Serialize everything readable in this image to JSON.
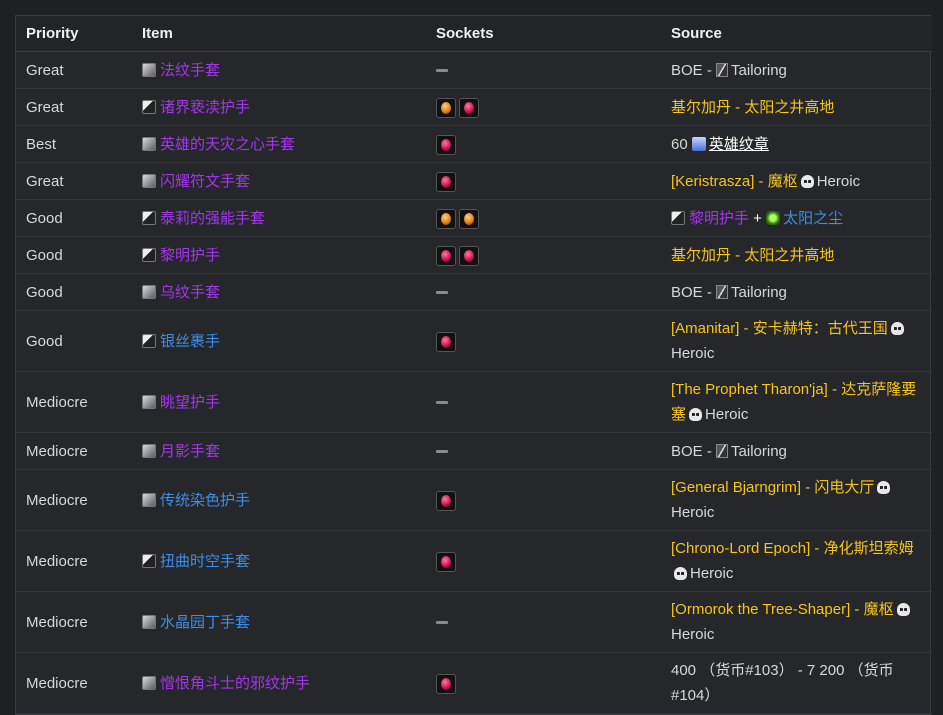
{
  "headers": {
    "priority": "Priority",
    "item": "Item",
    "sockets": "Sockets",
    "source": "Source"
  },
  "rows": [
    {
      "priority": "Great",
      "item": "法纹手套",
      "item_color": "purple",
      "icon": "cloth-gloves-icon",
      "sockets": [],
      "source": {
        "prefix": "BOE - ",
        "profession": "Tailoring"
      }
    },
    {
      "priority": "Great",
      "item": "诸界亵渎护手",
      "item_color": "purple",
      "icon": "dark-gloves-icon",
      "sockets": [
        "orange",
        "red"
      ],
      "source": {
        "npc": "基尔加丹",
        "sep": " - ",
        "zone": "太阳之井高地"
      }
    },
    {
      "priority": "Best",
      "item": "英雄的天灾之心手套",
      "item_color": "purple",
      "icon": "plate-gloves-icon",
      "sockets": [
        "red"
      ],
      "source": {
        "cost": "60 ",
        "currency": "英雄纹章"
      }
    },
    {
      "priority": "Great",
      "item": "闪耀符文手套",
      "item_color": "purple",
      "icon": "rune-gloves-icon",
      "sockets": [
        "red"
      ],
      "source": {
        "npc": "[Keristrasza]",
        "sep": " - ",
        "zone": "魔枢",
        "heroic": "Heroic"
      }
    },
    {
      "priority": "Good",
      "item": "泰莉的强能手套",
      "item_color": "purple",
      "icon": "hand-icon",
      "sockets": [
        "orange",
        "orange"
      ],
      "source": {
        "item_a": "黎明护手",
        "plus": " + ",
        "item_b": "太阳之尘"
      }
    },
    {
      "priority": "Good",
      "item": "黎明护手",
      "item_color": "purple",
      "icon": "hand-icon",
      "sockets": [
        "red",
        "red"
      ],
      "source": {
        "npc": "基尔加丹",
        "sep": " - ",
        "zone": "太阳之井高地"
      }
    },
    {
      "priority": "Good",
      "item": "乌纹手套",
      "item_color": "purple",
      "icon": "cloth-gloves-icon",
      "sockets": [],
      "source": {
        "prefix": "BOE - ",
        "profession": "Tailoring"
      }
    },
    {
      "priority": "Good",
      "item": "银丝裹手",
      "item_color": "blue",
      "icon": "hand-icon",
      "sockets": [
        "red"
      ],
      "source": {
        "npc": "[Amanitar]",
        "sep": " - ",
        "zone": "安卡赫特：古代王国",
        "heroic": "Heroic"
      }
    },
    {
      "priority": "Mediocre",
      "item": "眺望护手",
      "item_color": "purple",
      "icon": "mail-gloves-icon",
      "sockets": [],
      "source": {
        "npc": "[The Prophet Tharon'ja]",
        "sep": " - ",
        "zone": "达克萨隆要塞",
        "heroic": "Heroic"
      }
    },
    {
      "priority": "Mediocre",
      "item": "月影手套",
      "item_color": "purple",
      "icon": "cloth-gloves-icon",
      "sockets": [],
      "source": {
        "prefix": "BOE - ",
        "profession": "Tailoring"
      }
    },
    {
      "priority": "Mediocre",
      "item": "传统染色护手",
      "item_color": "blue",
      "icon": "cloth-gloves-icon",
      "sockets": [
        "red"
      ],
      "source": {
        "npc": "[General Bjarngrim]",
        "sep": " - ",
        "zone": "闪电大厅",
        "heroic": "Heroic"
      }
    },
    {
      "priority": "Mediocre",
      "item": "扭曲时空手套",
      "item_color": "blue",
      "icon": "hand-icon",
      "sockets": [
        "red"
      ],
      "source": {
        "npc": "[Chrono-Lord Epoch]",
        "sep": " - ",
        "zone": "净化斯坦索姆",
        "heroic": "Heroic"
      }
    },
    {
      "priority": "Mediocre",
      "item": "水晶园丁手套",
      "item_color": "blue",
      "icon": "plate-gloves-icon",
      "sockets": [],
      "source": {
        "npc": "[Ormorok the Tree-Shaper]",
        "sep": " - ",
        "zone": "魔枢",
        "heroic": "Heroic"
      }
    },
    {
      "priority": "Mediocre",
      "item": "憎恨角斗士的邪纹护手",
      "item_color": "purple",
      "icon": "rune-gloves-icon",
      "sockets": [
        "red"
      ],
      "source": {
        "text": "400 （货币#103） - 7 200 （货币#104）"
      }
    }
  ]
}
